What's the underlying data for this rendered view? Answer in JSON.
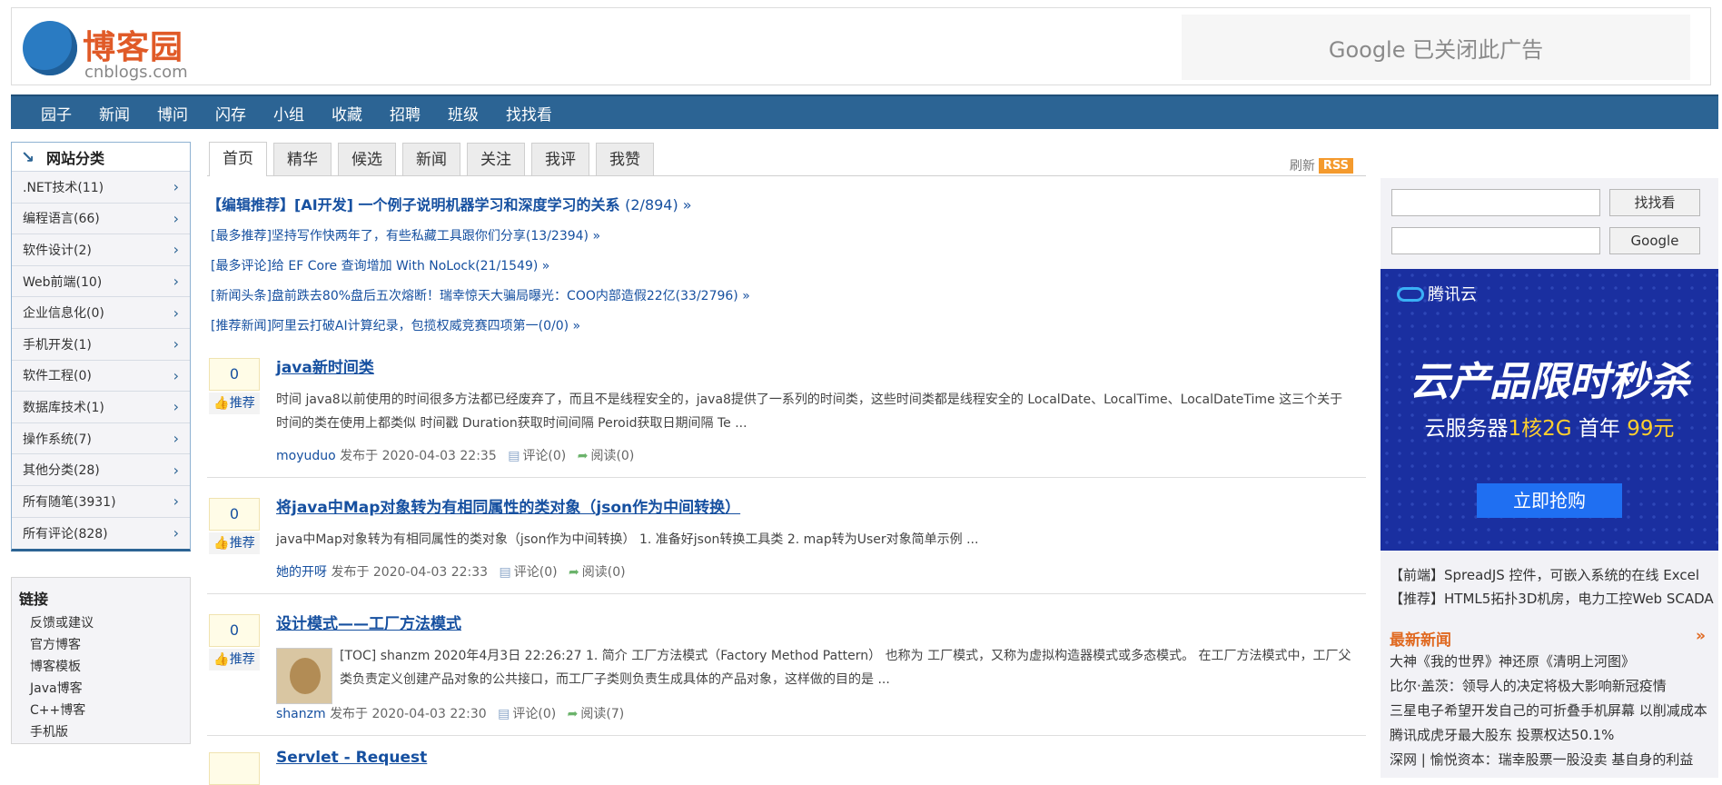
{
  "header": {
    "logo_name": "博客园",
    "logo_domain": "cnblogs.com",
    "ad_text": "Google 已关闭此广告"
  },
  "nav": [
    "园子",
    "新闻",
    "博问",
    "闪存",
    "小组",
    "收藏",
    "招聘",
    "班级",
    "找找看"
  ],
  "sidebar": {
    "category_title": "网站分类",
    "categories": [
      ".NET技术(11)",
      "编程语言(66)",
      "软件设计(2)",
      "Web前端(10)",
      "企业信息化(0)",
      "手机开发(1)",
      "软件工程(0)",
      "数据库技术(1)",
      "操作系统(7)",
      "其他分类(28)",
      "所有随笔(3931)",
      "所有评论(828)"
    ],
    "links_title": "链接",
    "links": [
      "反馈或建议",
      "官方博客",
      "博客模板",
      "Java博客",
      "C++博客",
      "手机版"
    ]
  },
  "main": {
    "tabs": [
      "首页",
      "精华",
      "候选",
      "新闻",
      "关注",
      "我评",
      "我赞"
    ],
    "refresh_label": "刷新",
    "rss_label": "RSS",
    "headline": {
      "text": "【编辑推荐】[AI开发] 一个例子说明机器学习和深度学习的关系",
      "count": "(2/894) »"
    },
    "recommendations": [
      "[最多推荐]坚持写作快两年了，有些私藏工具跟你们分享(13/2394) »",
      "[最多评论]给 EF Core 查询增加 With NoLock(21/1549) »",
      "[新闻头条]盘前跌去80%盘后五次熔断！瑞幸惊天大骗局曝光：COO内部造假22亿(33/2796) »",
      "[推荐新闻]阿里云打破AI计算纪录，包揽权威竞赛四项第一(0/0) »"
    ],
    "posts": [
      {
        "digg": "0",
        "digg_label": "推荐",
        "title": "java新时间类",
        "summary": "时间 java8以前使用的时间很多方法都已经废弃了，而且不是线程安全的，java8提供了一系列的时间类，这些时间类都是线程安全的 LocalDate、LocalTime、LocalDateTime 这三个关于时间的类在使用上都类似 时间戳 Duration获取时间间隔 Peroid获取日期间隔 Te ...",
        "author": "moyuduo",
        "posted": "发布于 2020-04-03 22:35",
        "comments": "评论(0)",
        "reads": "阅读(0)"
      },
      {
        "digg": "0",
        "digg_label": "推荐",
        "title": "将java中Map对象转为有相同属性的类对象（json作为中间转换）",
        "summary": "java中Map对象转为有相同属性的类对象（json作为中间转换） 1. 准备好json转换工具类 2. map转为User对象简单示例 ...",
        "author": "她的开呀",
        "posted": "发布于 2020-04-03 22:33",
        "comments": "评论(0)",
        "reads": "阅读(0)"
      },
      {
        "digg": "0",
        "digg_label": "推荐",
        "title": "设计模式——工厂方法模式",
        "summary": "[TOC] shanzm 2020年4月3日 22:26:27 1. 简介 工厂方法模式（Factory Method Pattern） 也称为 工厂模式，又称为虚拟构造器模式或多态模式。 在工厂方法模式中，工厂父类负责定义创建产品对象的公共接口，而工厂子类则负责生成具体的产品对象，这样做的目的是 ...",
        "author": "shanzm",
        "posted": "发布于 2020-04-03 22:30",
        "comments": "评论(0)",
        "reads": "阅读(7)"
      }
    ],
    "partial_title": "Servlet - Request"
  },
  "right": {
    "search_btn1": "找找看",
    "search_btn2": "Google",
    "ad": {
      "brand": "腾讯云",
      "big": "云产品限时秒杀",
      "sub_prefix": "云服务器",
      "sub_hl1": "1核2G",
      "sub_mid": " 首年 ",
      "sub_hl2": "99元",
      "cta": "立即抢购"
    },
    "promos": [
      "【前端】SpreadJS 控件，可嵌入系统的在线 Excel",
      "【推荐】HTML5拓扑3D机房，电力工控Web SCADA"
    ],
    "news_title": "最新新闻",
    "news_more": "»",
    "news": [
      "大神《我的世界》神还原《清明上河图》",
      "比尔·盖茨：领导人的决定将极大影响新冠疫情",
      "三星电子希望开发自己的可折叠手机屏幕 以削减成本",
      "腾讯成虎牙最大股东 投票权达50.1%",
      "深网 | 愉悦资本：瑞幸股票一股没卖 基自身的利益"
    ]
  },
  "colors": {
    "nav_bg": "#2c6494",
    "link": "#1650a0",
    "accent": "#e05a27",
    "rss": "#f49a2d"
  }
}
